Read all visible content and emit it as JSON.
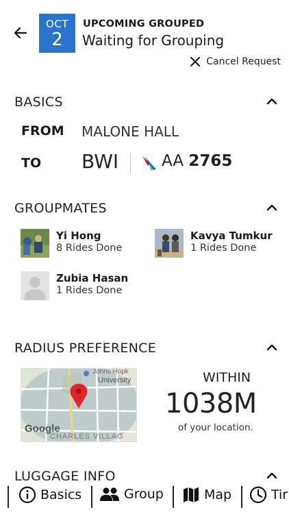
{
  "header": {
    "back_icon": "arrow-left-icon",
    "date_month": "OCT",
    "date_day": "2",
    "status_label": "UPCOMING GROUPED",
    "status_title": "Waiting for Grouping",
    "cancel_label": "Cancel Request",
    "cancel_icon": "close-icon",
    "accent_color": "#2a74c9"
  },
  "basics": {
    "title": "BASICS",
    "from_label": "FROM",
    "from_value": "MALONE HALL",
    "to_label": "TO",
    "to_value": "BWI",
    "airline_code": "AA",
    "flight_number": "2765"
  },
  "groupmates": {
    "title": "GROUPMATES",
    "members": [
      {
        "name": "Yi Hong",
        "rides": "8 Rides Done"
      },
      {
        "name": "Kavya Tumkur",
        "rides": "1 Rides Done"
      },
      {
        "name": "Zubia Hasan",
        "rides": "1 Rides Done"
      }
    ]
  },
  "radius": {
    "title": "RADIUS PREFERENCE",
    "within_label": "WITHIN",
    "distance": "1038M",
    "subtitle": "of your location.",
    "map_label_1": "Johns Hopk",
    "map_label_2": "University",
    "map_label_3": "CHARLES VILLAG",
    "map_brand": "Google"
  },
  "luggage": {
    "title": "LUGGAGE INFO"
  },
  "bottom_nav": {
    "items": [
      {
        "label": "Basics",
        "icon": "info-icon"
      },
      {
        "label": "Group",
        "icon": "people-icon"
      },
      {
        "label": "Map",
        "icon": "map-icon"
      },
      {
        "label": "Tir",
        "icon": "clock-icon"
      }
    ]
  }
}
